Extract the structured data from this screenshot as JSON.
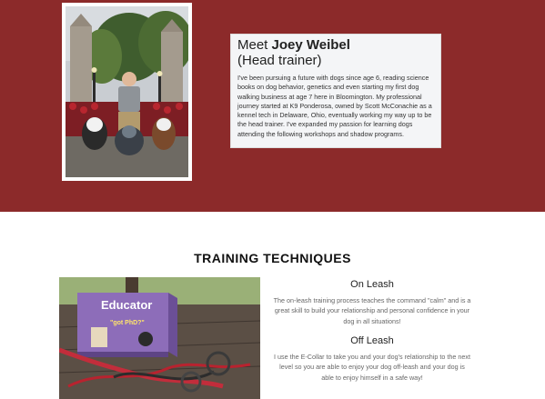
{
  "hero": {
    "bg_color": "#8c2a2a",
    "title_prefix": "Meet ",
    "trainer_name": "Joey Weibel",
    "role": "(Head trainer)",
    "bio": "I've been pursuing a future with dogs since age 6, reading science books on dog behavior, genetics and even starting my first dog walking business at age 7 here in Bloomington. My professional journey started at K9 Ponderosa, owned by Scott McConachie as a kennel tech in Delaware, Ohio, eventually working my way up to be the head trainer. I've expanded my passion for learning dogs attending the following workshops and shadow programs."
  },
  "training": {
    "heading": "TRAINING TECHNIQUES",
    "product_box": {
      "brand": "Educator",
      "tagline": "\"got PhD?\""
    },
    "techniques": [
      {
        "title": "On Leash",
        "text": "The on-leash training process teaches the command \"calm\" and is a great skill to build your relationship and personal confidence in your dog in all situations!"
      },
      {
        "title": "Off Leash",
        "text": "I use the E-Collar to take you and your dog's relationship to the next level so you are able to enjoy your dog off-leash and your dog is able to enjoy himself in a safe way!"
      }
    ]
  }
}
